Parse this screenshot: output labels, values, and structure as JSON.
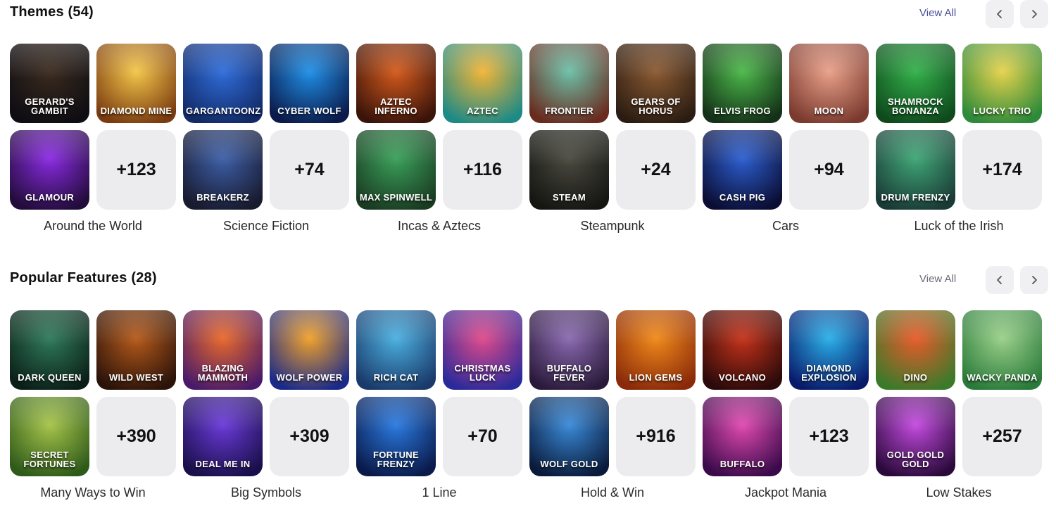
{
  "themes": {
    "title": "Themes (54)",
    "view_all": "View All",
    "groups": [
      {
        "label": "Around the World",
        "more": "+123",
        "tiles": [
          {
            "name": "Gerard's Gambit",
            "c1": "#3a2a1e",
            "c2": "#0e0d12"
          },
          {
            "name": "Diamond Mine",
            "c1": "#f3c64a",
            "c2": "#7a3b10"
          },
          {
            "name": "Glamour",
            "c1": "#8a2be2",
            "c2": "#220c3a"
          }
        ]
      },
      {
        "label": "Science Fiction",
        "more": "+74",
        "tiles": [
          {
            "name": "Gargantoonz",
            "c1": "#2f6cd9",
            "c2": "#122a66"
          },
          {
            "name": "Cyber Wolf",
            "c1": "#1f8fe6",
            "c2": "#0b1a4a"
          },
          {
            "name": "Breakerz",
            "c1": "#3d5fa8",
            "c2": "#181a2e"
          }
        ]
      },
      {
        "label": "Incas & Aztecs",
        "more": "+116",
        "tiles": [
          {
            "name": "Aztec Inferno",
            "c1": "#d35a1c",
            "c2": "#3a140a"
          },
          {
            "name": "Aztec",
            "c1": "#f2b436",
            "c2": "#1d8a86"
          },
          {
            "name": "Max Spinwell",
            "c1": "#3aa05a",
            "c2": "#1a3b22"
          }
        ]
      },
      {
        "label": "Steampunk",
        "more": "+24",
        "tiles": [
          {
            "name": "Frontier",
            "c1": "#6cc0a8",
            "c2": "#6a2a1e"
          },
          {
            "name": "Gears of Horus",
            "c1": "#8a5a32",
            "c2": "#2b1c12"
          },
          {
            "name": "Steam",
            "c1": "#4a4a40",
            "c2": "#151512"
          }
        ]
      },
      {
        "label": "Cars",
        "more": "+94",
        "tiles": [
          {
            "name": "Elvis Frog",
            "c1": "#4cb84a",
            "c2": "#143018"
          },
          {
            "name": "Moon",
            "c1": "#e8a089",
            "c2": "#7a3a2e"
          },
          {
            "name": "Cash Pig",
            "c1": "#2c5fd0",
            "c2": "#0b0d33"
          }
        ]
      },
      {
        "label": "Luck of the Irish",
        "more": "+174",
        "tiles": [
          {
            "name": "Shamrock Bonanza",
            "c1": "#33b04a",
            "c2": "#0f4a1d"
          },
          {
            "name": "Lucky Trio",
            "c1": "#e6d24c",
            "c2": "#2c8a3a"
          },
          {
            "name": "Drum Frenzy",
            "c1": "#3fa676",
            "c2": "#1a3a36"
          }
        ]
      }
    ]
  },
  "features": {
    "title": "Popular Features (28)",
    "view_all": "View All",
    "groups": [
      {
        "label": "Many Ways to Win",
        "more": "+390",
        "tiles": [
          {
            "name": "Dark Queen",
            "c1": "#2f7a5a",
            "c2": "#0b1f18"
          },
          {
            "name": "Wild West",
            "c1": "#b55a1a",
            "c2": "#2b130a"
          },
          {
            "name": "Secret Fortunes",
            "c1": "#a6c44a",
            "c2": "#2e5a1a"
          }
        ]
      },
      {
        "label": "Big Symbols",
        "more": "+309",
        "tiles": [
          {
            "name": "Blazing Mammoth",
            "c1": "#e8692a",
            "c2": "#4a1a6a"
          },
          {
            "name": "Wolf Power",
            "c1": "#f0a12a",
            "c2": "#1a2a8a"
          },
          {
            "name": "Deal Me In",
            "c1": "#6a3ad8",
            "c2": "#1a0f4a"
          }
        ]
      },
      {
        "label": "1 Line",
        "more": "+70",
        "tiles": [
          {
            "name": "Rich Cat",
            "c1": "#4bb0e0",
            "c2": "#1a3a6a"
          },
          {
            "name": "Christmas Luck",
            "c1": "#e04a8a",
            "c2": "#2a2a9a"
          },
          {
            "name": "Fortune Frenzy",
            "c1": "#2a7ae0",
            "c2": "#0a1a4a"
          }
        ]
      },
      {
        "label": "Hold & Win",
        "more": "+916",
        "tiles": [
          {
            "name": "Buffalo Fever",
            "c1": "#8a6ab0",
            "c2": "#2a1a3a"
          },
          {
            "name": "Lion Gems",
            "c1": "#f08a1a",
            "c2": "#8a2a0a"
          },
          {
            "name": "Wolf Gold",
            "c1": "#3a8ad8",
            "c2": "#0a1a3a"
          }
        ]
      },
      {
        "label": "Jackpot Mania",
        "more": "+123",
        "tiles": [
          {
            "name": "Volcano",
            "c1": "#c4321a",
            "c2": "#2a0a0a"
          },
          {
            "name": "Diamond Explosion",
            "c1": "#2ab0e8",
            "c2": "#0a1a6a"
          },
          {
            "name": "Buffalo",
            "c1": "#e04ab0",
            "c2": "#3a0a4a"
          }
        ]
      },
      {
        "label": "Low Stakes",
        "more": "+257",
        "tiles": [
          {
            "name": "Dino",
            "c1": "#e85a2a",
            "c2": "#3a7a2a"
          },
          {
            "name": "Wacky Panda",
            "c1": "#9ad08a",
            "c2": "#2a7a3a"
          },
          {
            "name": "Gold Gold Gold",
            "c1": "#c44ae0",
            "c2": "#2a0a3a"
          }
        ]
      }
    ]
  }
}
